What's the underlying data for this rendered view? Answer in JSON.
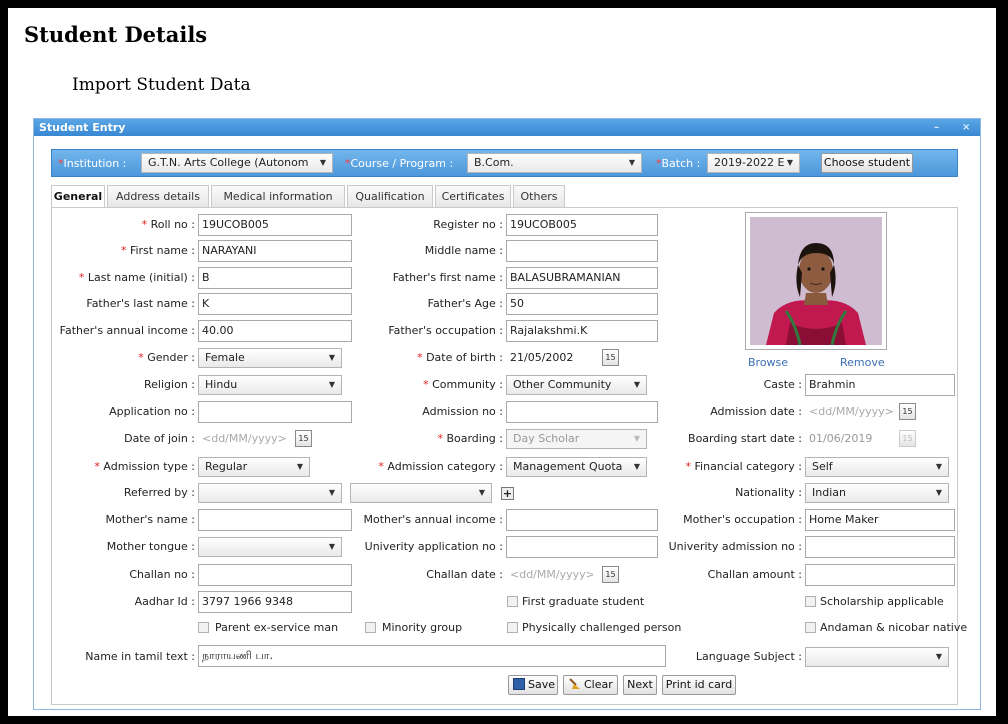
{
  "page": {
    "title": "Student Details",
    "subtitle": "Import Student Data"
  },
  "window": {
    "title": "Student Entry",
    "minimize": "–",
    "close": "×"
  },
  "topbar": {
    "institution_label": "Institution :",
    "institution_value": "G.T.N. Arts College (Autonom",
    "course_label": "Course / Program :",
    "course_value": "B.Com.",
    "batch_label": "Batch :",
    "batch_value": "2019-2022 E",
    "choose_button": "Choose student",
    "required_mark": "*"
  },
  "tabs": [
    "General",
    "Address details",
    "Medical information",
    "Qualification",
    "Certificates",
    "Others"
  ],
  "col1": {
    "roll_no": {
      "label": "Roll no :",
      "value": "19UCOB005"
    },
    "first_name": {
      "label": "First name :",
      "value": "NARAYANI"
    },
    "last_name": {
      "label": "Last name (initial) :",
      "value": "B"
    },
    "fathers_last_name": {
      "label": "Father's last name :",
      "value": "K"
    },
    "fathers_income": {
      "label": "Father's annual income :",
      "value": "40.00"
    },
    "gender": {
      "label": "Gender :",
      "value": "Female"
    },
    "religion": {
      "label": "Religion :",
      "value": "Hindu"
    },
    "application_no": {
      "label": "Application no :",
      "value": ""
    },
    "date_of_join": {
      "label": "Date of join :",
      "placeholder": "<dd/MM/yyyy>"
    },
    "admission_type": {
      "label": "Admission type :",
      "value": "Regular"
    },
    "referred_by": {
      "label": "Referred by :",
      "value": ""
    },
    "mothers_name": {
      "label": "Mother's name :",
      "value": ""
    },
    "mother_tongue": {
      "label": "Mother tongue :",
      "value": ""
    },
    "challan_no": {
      "label": "Challan no :",
      "value": ""
    },
    "aadhar_id": {
      "label": "Aadhar Id :",
      "value": "3797 1966 9348"
    }
  },
  "col2": {
    "register_no": {
      "label": "Register no :",
      "value": "19UCOB005"
    },
    "middle_name": {
      "label": "Middle name :",
      "value": ""
    },
    "fathers_first_name": {
      "label": "Father's first name :",
      "value": "BALASUBRAMANIAN"
    },
    "fathers_age": {
      "label": "Father's Age :",
      "value": "50"
    },
    "fathers_occupation": {
      "label": "Father's occupation :",
      "value": "Rajalakshmi.K"
    },
    "date_of_birth": {
      "label": "Date of birth :",
      "value": "21/05/2002"
    },
    "community": {
      "label": "Community :",
      "value": "Other Community"
    },
    "admission_no": {
      "label": "Admission no :",
      "value": ""
    },
    "boarding": {
      "label": "Boarding :",
      "value": "Day Scholar"
    },
    "admission_category": {
      "label": "Admission category :",
      "value": "Management Quota"
    },
    "referred_by_2": {
      "value": ""
    },
    "mothers_income": {
      "label": "Mother's annual income :",
      "value": ""
    },
    "univ_app_no": {
      "label": "Univerity application no :",
      "value": ""
    },
    "challan_date": {
      "label": "Challan date :",
      "placeholder": "<dd/MM/yyyy>"
    }
  },
  "col3": {
    "browse": "Browse",
    "remove": "Remove",
    "caste": {
      "label": "Caste :",
      "value": "Brahmin"
    },
    "admission_date": {
      "label": "Admission date :",
      "placeholder": "<dd/MM/yyyy>"
    },
    "boarding_start_date": {
      "label": "Boarding start date :",
      "value": "01/06/2019"
    },
    "financial_category": {
      "label": "Financial category :",
      "value": "Self"
    },
    "nationality": {
      "label": "Nationality :",
      "value": "Indian"
    },
    "mothers_occupation": {
      "label": "Mother's occupation :",
      "value": "Home Maker"
    },
    "univ_admission_no": {
      "label": "Univerity admission no :",
      "value": ""
    },
    "challan_amount": {
      "label": "Challan amount :",
      "value": ""
    },
    "language_subject": {
      "label": "Language Subject :",
      "value": ""
    }
  },
  "calendar_glyph": "15",
  "plus_glyph": "+",
  "checkboxes": {
    "first_graduate": "First graduate student",
    "scholarship": "Scholarship applicable",
    "parent_ex_service": "Parent ex-service man",
    "minority": "Minority group",
    "physically_challenged": "Physically challenged person",
    "andaman": "Andaman & nicobar native"
  },
  "tamil_name": {
    "label": "Name in tamil text :",
    "value": "நாராயணி பா."
  },
  "actions": {
    "save": "Save",
    "clear": "Clear",
    "next": "Next",
    "print": "Print id card"
  },
  "colors": {
    "accent": "#4c97dc",
    "required": "#e02020",
    "link": "#3b6fb2"
  }
}
